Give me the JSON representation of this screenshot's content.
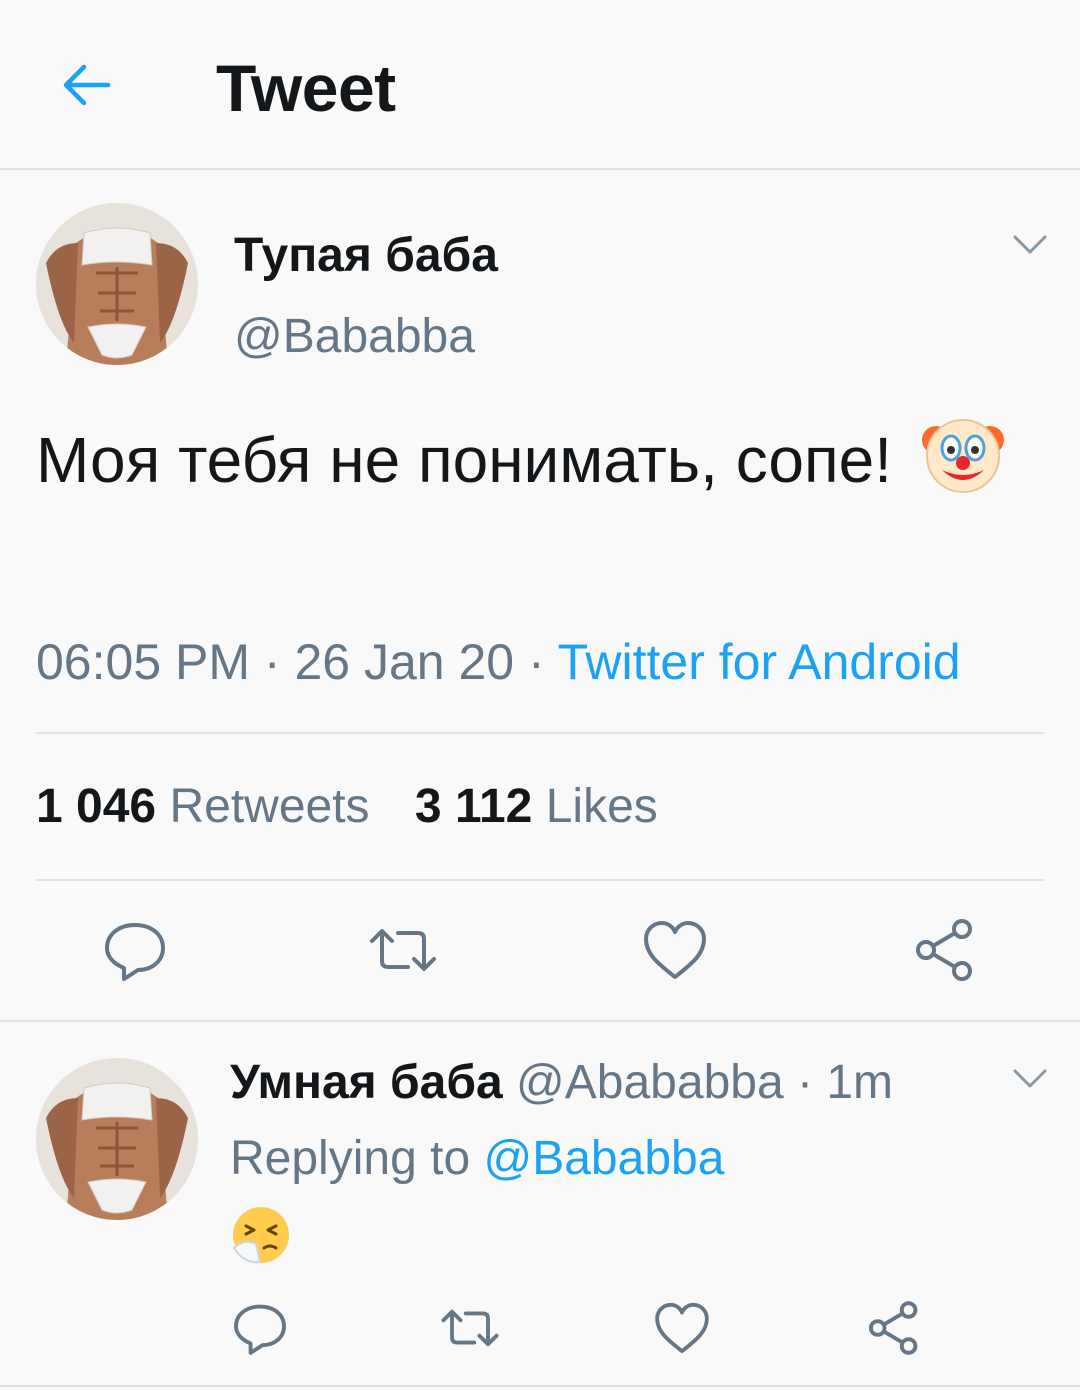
{
  "header": {
    "title": "Tweet",
    "back_icon": "arrow-left-icon"
  },
  "main_tweet": {
    "author_name": "Тупая баба",
    "author_handle": "@Bababba",
    "text": "Моя тебя не понимать, сопе!",
    "emoji": "clown-face-emoji",
    "time": "06:05 PM",
    "date": "26 Jan 20",
    "separator": " · ",
    "source": "Twitter for Android",
    "retweets_count": "1 046",
    "retweets_label": "Retweets",
    "likes_count": "3 112",
    "likes_label": "Likes"
  },
  "reply": {
    "author_name": "Умная баба",
    "author_handle": "@Abababba",
    "separator": " · ",
    "time_ago": "1m",
    "replying_prefix": "Replying to",
    "replying_to": "@Bababba",
    "emoji": "sneezing-face-emoji"
  },
  "actions": [
    "reply-icon",
    "retweet-icon",
    "like-icon",
    "share-icon"
  ],
  "colors": {
    "accent": "#1da1f2",
    "muted": "#657786",
    "text": "#14171a",
    "icon": "#657786",
    "divider": "#dde2e6"
  }
}
